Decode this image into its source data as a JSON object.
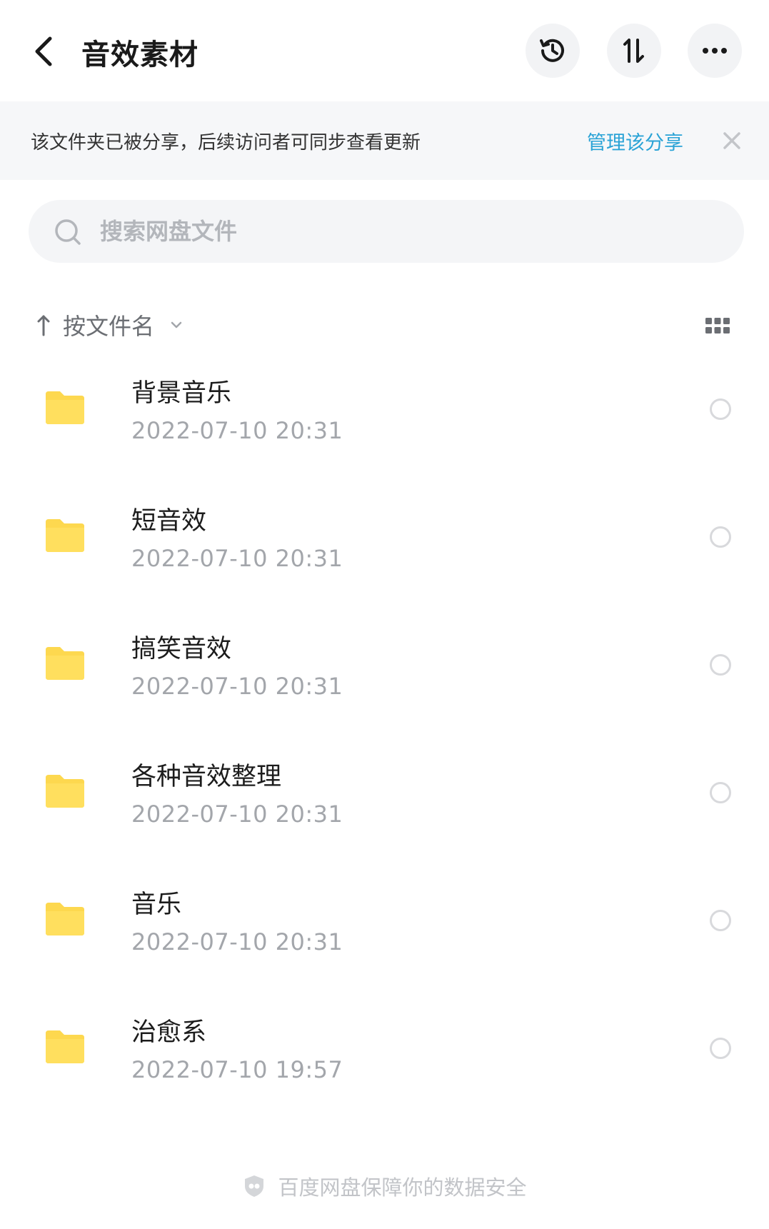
{
  "header": {
    "title": "音效素材"
  },
  "banner": {
    "text": "该文件夹已被分享，后续访问者可同步查看更新",
    "link": "管理该分享"
  },
  "search": {
    "placeholder": "搜索网盘文件"
  },
  "sort": {
    "label": "按文件名"
  },
  "files": [
    {
      "name": "背景音乐",
      "date": "2022-07-10  20:31"
    },
    {
      "name": "短音效",
      "date": "2022-07-10  20:31"
    },
    {
      "name": "搞笑音效",
      "date": "2022-07-10  20:31"
    },
    {
      "name": "各种音效整理",
      "date": "2022-07-10  20:31"
    },
    {
      "name": "音乐",
      "date": "2022-07-10  20:31"
    },
    {
      "name": "治愈系",
      "date": "2022-07-10  19:57"
    }
  ],
  "footer": {
    "text": "百度网盘保障你的数据安全"
  },
  "colors": {
    "accent": "#2aa3d6",
    "folder": "#fdd84f"
  },
  "icons": {
    "back": "chevron-left-icon",
    "history": "history-icon",
    "transfer": "transfer-icon",
    "more": "more-icon",
    "close": "close-icon",
    "search": "search-icon",
    "sort": "arrow-up-icon",
    "grid": "grid-icon",
    "folder": "folder-icon",
    "footer": "shield-icon"
  }
}
